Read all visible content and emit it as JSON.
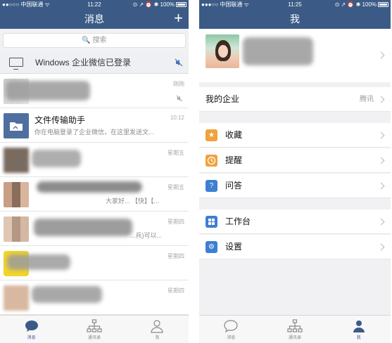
{
  "left": {
    "status": {
      "carrier": "●●○○○ 中国联通 ᯤ",
      "time": "11:22",
      "battery": "⊙ ↗ ⏰ ✱ 100%"
    },
    "nav": {
      "title": "消息",
      "plus": "+"
    },
    "search": {
      "placeholder": "🔍 搜索"
    },
    "notice": {
      "text": "Windows 企业微信已登录"
    },
    "conversations": [
      {
        "title": "",
        "preview": "",
        "time": "刚刚"
      },
      {
        "title": "文件传输助手",
        "preview": "你在电脑登录了企业微信，在这里发送文...",
        "time": "10:12"
      },
      {
        "title": "",
        "preview": "",
        "time": "星期五"
      },
      {
        "title": "",
        "preview": "大家好... 【快】【...",
        "time": "星期五"
      },
      {
        "title": "",
        "preview": "...兵)可以...",
        "time": "星期四"
      },
      {
        "title": "",
        "preview": "",
        "time": "星期四"
      },
      {
        "title": "",
        "preview": "",
        "time": "星期四"
      }
    ],
    "tabs": [
      {
        "label": "消息",
        "icon": "chat-bubble-icon"
      },
      {
        "label": "通讯录",
        "icon": "org-chart-icon"
      },
      {
        "label": "我",
        "icon": "person-icon"
      }
    ]
  },
  "right": {
    "status": {
      "carrier": "●●●○○ 中国联通 ᯤ",
      "time": "11:25",
      "battery": "⊙ ↗ ⏰ ✱ 100%"
    },
    "nav": {
      "title": "我"
    },
    "enterprise": {
      "label": "我的企业",
      "value": "腾讯"
    },
    "group1": [
      {
        "label": "收藏",
        "icon": "star-icon",
        "color": "#f0a23a"
      },
      {
        "label": "提醒",
        "icon": "clock-icon",
        "color": "#f0a23a"
      },
      {
        "label": "问答",
        "icon": "question-icon",
        "color": "#3d7fd1"
      }
    ],
    "group2": [
      {
        "label": "工作台",
        "icon": "grid-icon",
        "color": "#3d7fd1"
      },
      {
        "label": "设置",
        "icon": "gear-icon",
        "color": "#3d7fd1"
      }
    ],
    "tabs": [
      {
        "label": "消息",
        "icon": "chat-bubble-icon"
      },
      {
        "label": "通讯录",
        "icon": "org-chart-icon"
      },
      {
        "label": "我",
        "icon": "person-icon"
      }
    ]
  },
  "colors": {
    "nav": "#3b5b86",
    "accent": "#3d7fd1"
  }
}
